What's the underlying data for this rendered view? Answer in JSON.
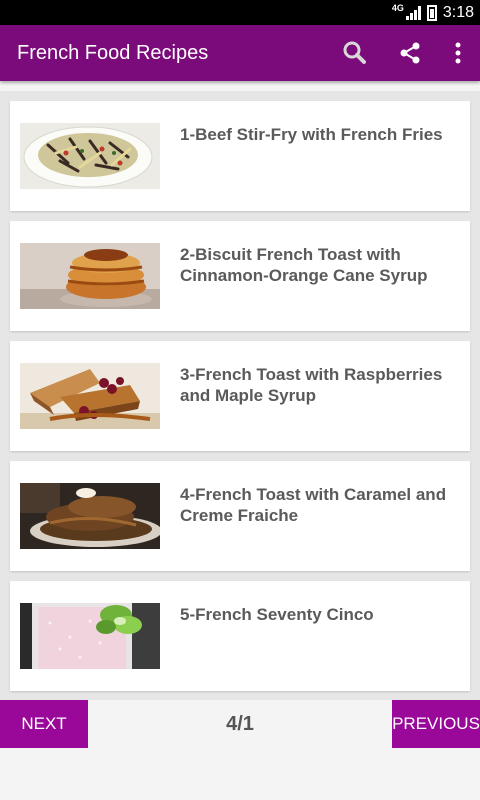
{
  "status_bar": {
    "network": "4G",
    "time": "3:18"
  },
  "app_bar": {
    "title": "French Food Recipes",
    "actions": [
      "search-icon",
      "share-icon",
      "more-vert-icon"
    ]
  },
  "recipes": [
    {
      "title": "1-Beef Stir-Fry with French Fries"
    },
    {
      "title": "2-Biscuit French Toast with Cinnamon-Orange Cane Syrup"
    },
    {
      "title": "3-French Toast with Raspberries and Maple Syrup"
    },
    {
      "title": "4-French Toast with Caramel and Creme Fraiche"
    },
    {
      "title": "5-French Seventy Cinco"
    }
  ],
  "pagination": {
    "next_label": "NEXT",
    "page_indicator": "4/1",
    "previous_label": "PREVIOUS"
  },
  "colors": {
    "app_bar": "#7b0a7b",
    "buttons": "#990899",
    "title_text": "#5a5a5a"
  }
}
